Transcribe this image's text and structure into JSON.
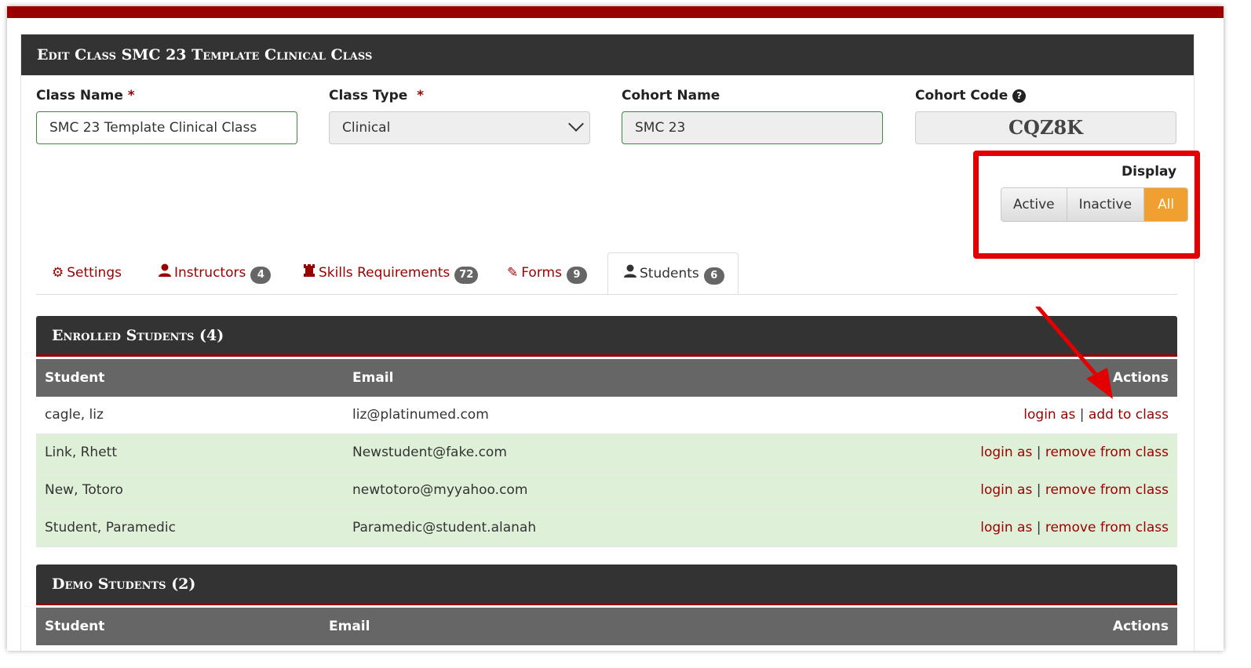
{
  "panel": {
    "title": "Edit Class SMC 23 Template Clinical Class"
  },
  "form": {
    "class_name": {
      "label": "Class Name",
      "required": "*",
      "value": "SMC 23 Template Clinical Class"
    },
    "class_type": {
      "label": "Class Type",
      "required": "*",
      "value": "Clinical"
    },
    "cohort_name": {
      "label": "Cohort Name",
      "value": "SMC 23"
    },
    "cohort_code": {
      "label": "Cohort Code",
      "value": "CQZ8K",
      "help_icon": "question-circle-icon"
    }
  },
  "display": {
    "label": "Display",
    "options": [
      "Active",
      "Inactive",
      "All"
    ],
    "selected": "All",
    "selected_color": "#f0a030"
  },
  "tabs": [
    {
      "label": "Settings",
      "icon": "gear-icon"
    },
    {
      "label": "Instructors",
      "icon": "user-icon",
      "count": "4"
    },
    {
      "label": "Skills Requirements",
      "icon": "chess-rook-icon",
      "count": "72"
    },
    {
      "label": "Forms",
      "icon": "pencil-icon",
      "count": "9"
    },
    {
      "label": "Students",
      "icon": "user-icon",
      "count": "6",
      "active": true
    }
  ],
  "enrolled": {
    "title": "Enrolled Students (4)",
    "columns": [
      "Student",
      "Email",
      "Actions"
    ],
    "rows": [
      {
        "student": "cagle, liz",
        "email": "liz@platinumed.com",
        "action1": "login as",
        "action2": "add to class"
      },
      {
        "student": "Link, Rhett",
        "email": "Newstudent@fake.com",
        "action1": "login as",
        "action2": "remove from class"
      },
      {
        "student": "New, Totoro",
        "email": "newtotoro@myyahoo.com",
        "action1": "login as",
        "action2": "remove from class"
      },
      {
        "student": "Student, Paramedic",
        "email": "Paramedic@student.alanah",
        "action1": "login as",
        "action2": "remove from class"
      }
    ],
    "separator": "|"
  },
  "demo": {
    "title": "Demo Students (2)",
    "columns": [
      "Student",
      "Email",
      "Actions"
    ]
  },
  "colors": {
    "brand": "#9b0000",
    "header": "#333333",
    "enrolled_row": "#dff0d8",
    "highlight": "#e30000"
  }
}
